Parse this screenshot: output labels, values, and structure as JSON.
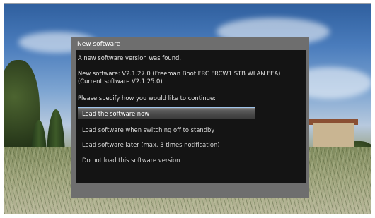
{
  "dialog": {
    "title": "New software",
    "message": "A new software version was found.",
    "new_software": "New software: V2.1.27.0 (Freeman Boot FRC FRCW1 STB WLAN FEA)",
    "current_software": "(Current software V2.1.25.0)",
    "prompt": "Please specify how you would like to continue:",
    "options": [
      {
        "label": "Load the software now",
        "selected": true
      },
      {
        "label": "Load software when switching off to standby",
        "selected": false
      },
      {
        "label": "Load software later (max. 3 times notification)",
        "selected": false
      },
      {
        "label": "Do not load this software version",
        "selected": false
      }
    ],
    "highlight_color": "#9fc3ea"
  }
}
